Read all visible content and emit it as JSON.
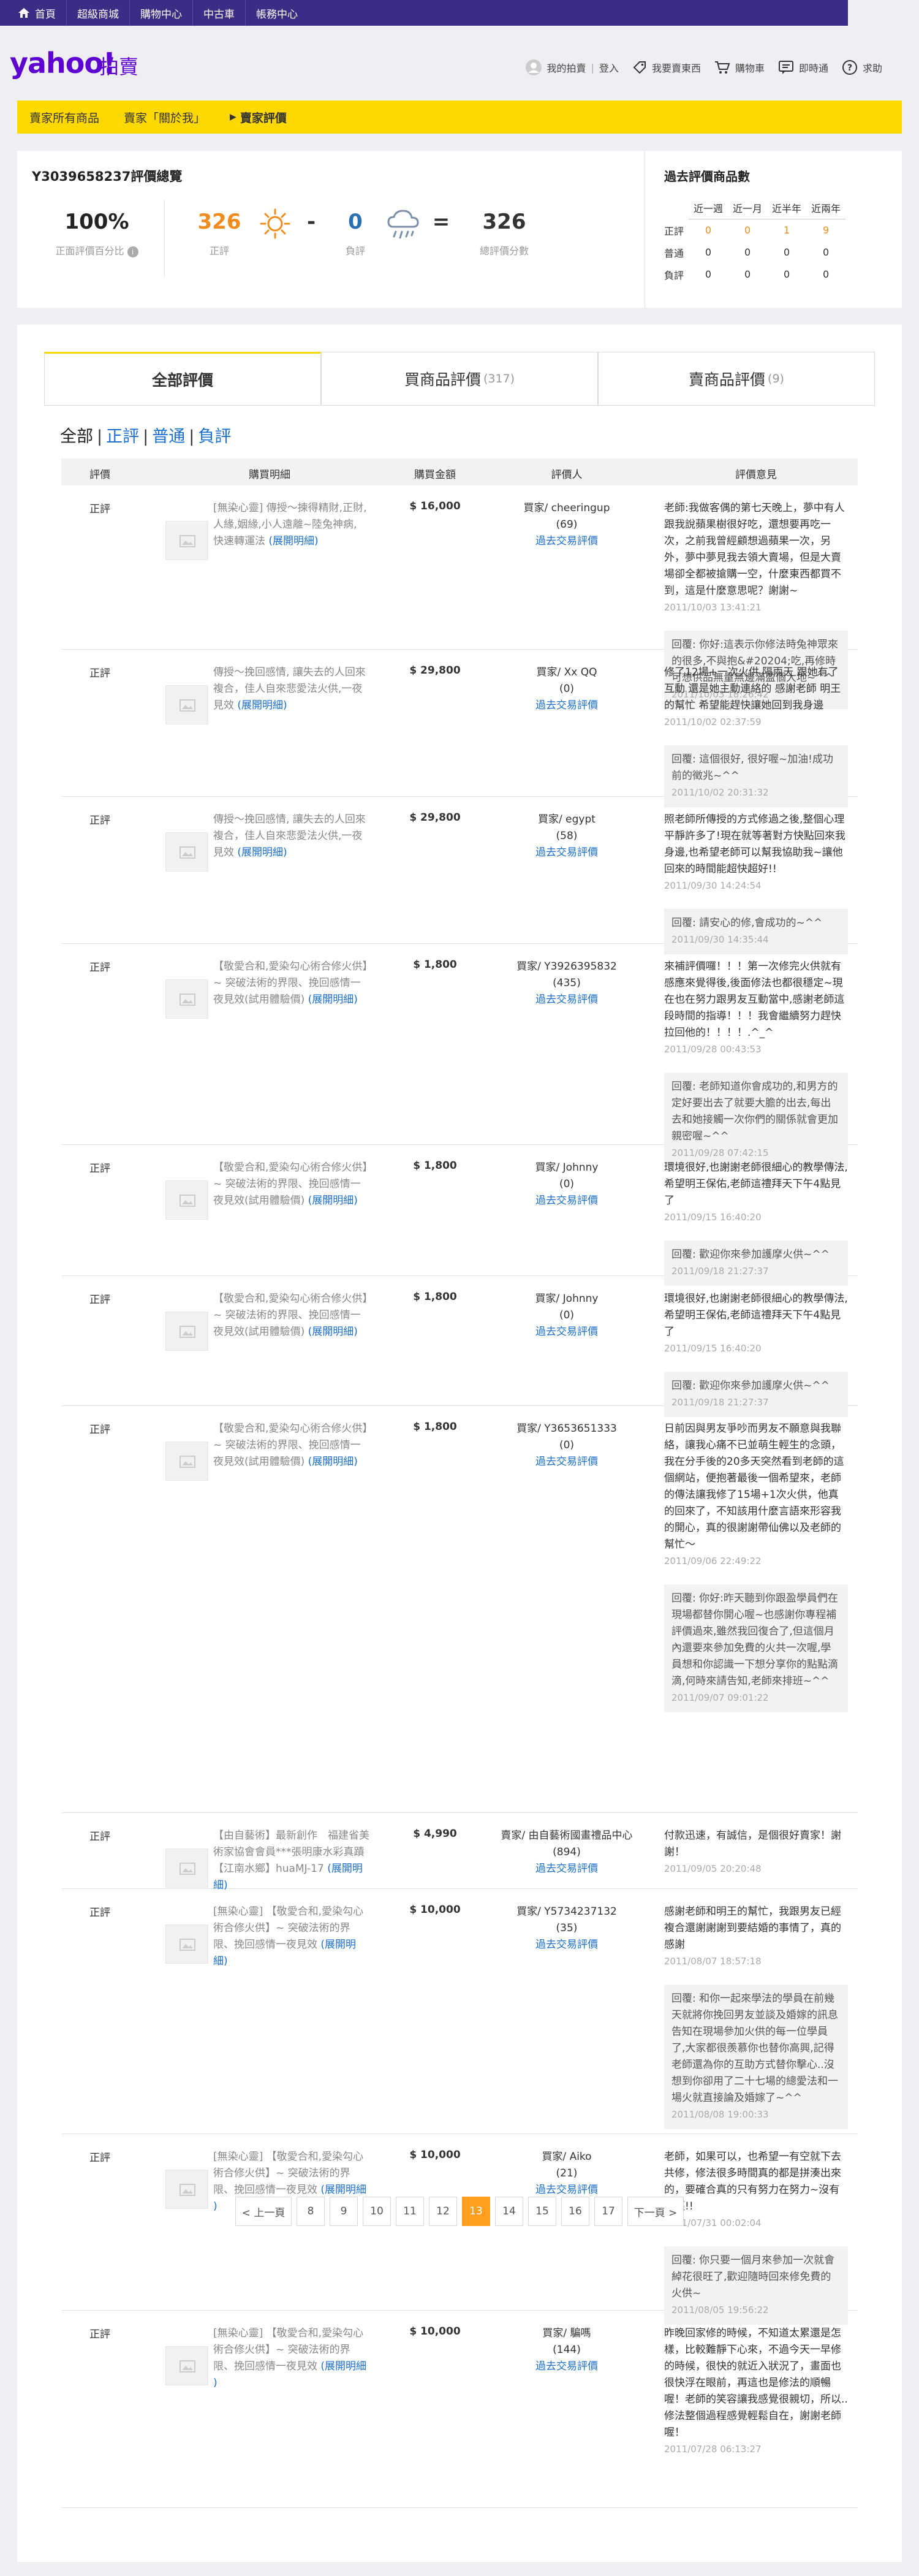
{
  "topnav": [
    "首頁",
    "超級商城",
    "購物中心",
    "中古車",
    "帳務中心"
  ],
  "brand": {
    "logo": "yahoo!",
    "sub": "拍賣"
  },
  "header": {
    "my_auction": "我的拍賣",
    "login": "登入",
    "sell": "我要賣東西",
    "cart": "購物車",
    "messenger": "即時通",
    "help": "求助"
  },
  "breadcrumb": {
    "items": [
      "賣家所有商品",
      "賣家「關於我」",
      "賣家評價"
    ]
  },
  "summary": {
    "title": "Y3039658237評價總覽",
    "positive_rate": "100%",
    "positive_rate_label": "正面評價百分比",
    "positive": "326",
    "positive_label": "正評",
    "minus": "-",
    "negative": "0",
    "negative_label": "負評",
    "equals": "=",
    "total": "326",
    "total_label": "總評價分數"
  },
  "past_ratings": {
    "title": "過去評價商品數",
    "columns": [
      "近一週",
      "近一月",
      "近半年",
      "近兩年"
    ],
    "rows": [
      {
        "label": "正評",
        "values": [
          "0",
          "0",
          "1",
          "9"
        ]
      },
      {
        "label": "普通",
        "values": [
          "0",
          "0",
          "0",
          "0"
        ]
      },
      {
        "label": "負評",
        "values": [
          "0",
          "0",
          "0",
          "0"
        ]
      }
    ]
  },
  "tabs": [
    {
      "label": "全部評價",
      "count": ""
    },
    {
      "label": "買商品評價",
      "count": "(317)"
    },
    {
      "label": "賣商品評價",
      "count": "(9)"
    }
  ],
  "filters": [
    "全部",
    "正評",
    "普通",
    "負評"
  ],
  "table_headers": [
    "評價",
    "購買明細",
    "購買金額",
    "評價人",
    "評價意見"
  ],
  "rows": [
    {
      "type": "正評",
      "item": "[無染心靈] 傳授～揀得精財,正財,人緣,姻緣,小人遠離~陸兔神病, 快速轉運法",
      "expand": "(展開明細)",
      "price": "$ 16,000",
      "rater": "買家/ cheeringup",
      "rater_score": "(69)",
      "history": "過去交易評價",
      "comment": "老師:我做客偶的第七天晚上，夢中有人跟我說蘋果樹很好吃，還想要再吃一次，之前我曾經顧想過蘋果一次，另外，夢中夢見我去領大賣場，但是大賣場卻全都被搶購一空，什麼東西都買不到，這是什麼意思呢？謝謝~",
      "comment_ts": "2011/10/03 13:41:21",
      "reply": "回覆: 你好:這表示你修法時兔神眾來的很多,不與抱&#20204;吃,再修時可想供品無量無邊滿盈個大地~^^",
      "reply_ts": "2011/10/03 18:26:42"
    },
    {
      "type": "正評",
      "item": "傳授～挽回感情, 讓失去的人回來複合，佳人自來悲愛法火供,一夜見效",
      "expand": "(展開明細)",
      "price": "$ 29,800",
      "rater": "買家/ Xx QQ",
      "rater_score": "(0)",
      "history": "過去交易評價",
      "comment": "修了12場+一次火供 隔兩天 跟她有了互動 還是她主動連絡的 感謝老師 明王的幫忙 希望能趕快讓她回到我身邊",
      "comment_ts": "2011/10/02 02:37:59",
      "reply": "回覆: 這個很好, 很好喔~加油!成功前的徵兆~^^",
      "reply_ts": "2011/10/02 20:31:32"
    },
    {
      "type": "正評",
      "item": "傳授～挽回感情, 讓失去的人回來複合，佳人自來悲愛法火供,一夜見效",
      "expand": "(展開明細)",
      "price": "$ 29,800",
      "rater": "買家/ egypt",
      "rater_score": "(58)",
      "history": "過去交易評價",
      "comment": "照老師所傳授的方式修過之後,整個心理平靜許多了!現在就等著對方快點回來我身邊,也希望老師可以幫我協助我~讓他回來的時間能超快超好!!",
      "comment_ts": "2011/09/30 14:24:54",
      "reply": "回覆: 請安心的修,會成功的~^^",
      "reply_ts": "2011/09/30 14:35:44"
    },
    {
      "type": "正評",
      "item": "【敬愛合和,愛染勾心術合修火供】~ 突破法術的界限、挽回感情一夜見效(試用體驗價)",
      "expand": "(展開明細)",
      "price": "$ 1,800",
      "rater": "買家/ Y3926395832",
      "rater_score": "(435)",
      "history": "過去交易評價",
      "comment": "來補評價囉！！！第一次修完火供就有感應來覺得後,後面修法也都很穩定~現在也在努力跟男友互動當中,感謝老師這段時間的指導！！！我會繼續努力趕快拉回他的！！！！.^_^",
      "comment_ts": "2011/09/28 00:43:53",
      "reply": "回覆: 老師知道你會成功的,和男方的定好要出去了就要大膽的出去,每出去和她接觸一次你們的關係就會更加親密喔~^^",
      "reply_ts": "2011/09/28 07:42:15"
    },
    {
      "type": "正評",
      "item": "【敬愛合和,愛染勾心術合修火供】~ 突破法術的界限、挽回感情一夜見效(試用體驗價)",
      "expand": "(展開明細)",
      "price": "$ 1,800",
      "rater": "買家/ Johnny",
      "rater_score": "(0)",
      "history": "過去交易評價",
      "comment": "環境很好,也謝謝老師很細心的教學傳法, 希望明王保佑,老師這禮拜天下午4點見了",
      "comment_ts": "2011/09/15 16:40:20",
      "reply": "回覆: 歡迎你來參加護摩火供~^^",
      "reply_ts": "2011/09/18 21:27:37"
    },
    {
      "type": "正評",
      "item": "【敬愛合和,愛染勾心術合修火供】~ 突破法術的界限、挽回感情一夜見效(試用體驗價)",
      "expand": "(展開明細)",
      "price": "$ 1,800",
      "rater": "買家/ Johnny",
      "rater_score": "(0)",
      "history": "過去交易評價",
      "comment": "環境很好,也謝謝老師很細心的教學傳法, 希望明王保佑,老師這禮拜天下午4點見了",
      "comment_ts": "2011/09/15 16:40:20",
      "reply": "回覆: 歡迎你來參加護摩火供~^^",
      "reply_ts": "2011/09/18 21:27:37"
    },
    {
      "type": "正評",
      "item": "【敬愛合和,愛染勾心術合修火供】~ 突破法術的界限、挽回感情一夜見效(試用體驗價)",
      "expand": "(展開明細)",
      "price": "$ 1,800",
      "rater": "買家/ Y3653651333",
      "rater_score": "(0)",
      "history": "過去交易評價",
      "comment": "日前因與男友爭吵而男友不願意與我聯絡，讓我心痛不已並萌生輕生的念頭，我在分手後的20多天突然看到老師的這個網站，便抱著最後一個希望來，老師的傳法讓我修了15場+1次火供，他真的回來了，不知該用什麼言語來形容我的開心，真的很謝謝帶仙佛以及老師的幫忙～",
      "comment_ts": "2011/09/06 22:49:22",
      "reply": "回覆: 你好:昨天聽到你跟盈學員們在現場都替你開心喔~也感謝你專程補評價過來,雖然我回復合了,但這個月內還要來參加免費的火共一次喔,學員想和你認識一下想分享你的點點滴滴,何時來請告知,老師來排班~^^",
      "reply_ts": "2011/09/07 09:01:22"
    },
    {
      "type": "正評",
      "item": "【由自藝術】最新創作　福建省美術家協會會員***張明康水彩真蹟【江南水鄉】huaMJ-17",
      "expand": "(展開明細)",
      "price": "$ 4,990",
      "rater": "賣家/ 由自藝術國畫禮品中心",
      "rater_score": "(894)",
      "history": "過去交易評價",
      "comment": "付款迅速，有誠信，是個很好賣家！謝謝！",
      "comment_ts": "2011/09/05 20:20:48",
      "reply": "",
      "reply_ts": ""
    },
    {
      "type": "正評",
      "item": "[無染心靈] 【敬愛合和,愛染勾心術合修火供】~ 突破法術的界限、挽回感情一夜見效",
      "expand": "(展開明細)",
      "price": "$ 10,000",
      "rater": "買家/ Y5734237132",
      "rater_score": "(35)",
      "history": "過去交易評價",
      "comment": "感謝老師和明王的幫忙，我跟男友已經複合還謝謝謝到要結婚的事情了，真的感謝",
      "comment_ts": "2011/08/07 18:57:18",
      "reply": "回覆: 和你一起來學法的學員在前幾天就將你挽回男友並談及婚嫁的訊息告知在現場參加火供的每一位學員了,大家都很羨慕你也替你高興,記得老師還為你的互助方式替你擊心..沒想到你卻用了二十七場的總愛法和一場火就直接論及婚嫁了~^^",
      "reply_ts": "2011/08/08 19:00:33"
    },
    {
      "type": "正評",
      "item": "[無染心靈] 【敬愛合和,愛染勾心術合修火供】~ 突破法術的界限、挽回感情一夜見效",
      "expand": "(展開明細",
      "expand_tail": ")",
      "price": "$ 10,000",
      "rater": "買家/ Aiko",
      "rater_score": "(21)",
      "history": "過去交易評價",
      "comment": "老師，如果可以，也希望一有空就下去共修，修法很多時間真的都是拼湊出來的，要確合真的只有努力在努力~沒有捷徑!!",
      "comment_ts": "2011/07/31 00:02:04",
      "reply": "回覆: 你只要一個月來參加一次就會綽花很旺了,歡迎隨時回來修免費的火供~",
      "reply_ts": "2011/08/05 19:56:22"
    },
    {
      "type": "正評",
      "item": "[無染心靈] 【敬愛合和,愛染勾心術合修火供】~ 突破法術的界限、挽回感情一夜見效",
      "expand": "(展開明細",
      "expand_tail": ")",
      "price": "$ 10,000",
      "rater": "買家/ 騙嗎",
      "rater_score": "(144)",
      "history": "過去交易評價",
      "comment": "昨晚回家修的時候，不知道太累還是怎樣，比較難靜下心來，不過今天一早修的時候，很快的就近入狀況了，畫面也很快浮在眼前，再這也是修法的順暢喔！老師的笑容讓我感覺很親切，所以..修法整個過程感覺輕鬆自在，謝謝老師喔！",
      "comment_ts": "2011/07/28 06:13:27",
      "reply": "",
      "reply_ts": ""
    }
  ],
  "pager": {
    "prev": "< 上一頁",
    "pages": [
      "8",
      "9",
      "10",
      "11",
      "12",
      "13",
      "14",
      "15",
      "16",
      "17"
    ],
    "current": "13",
    "next": "下一頁 >"
  },
  "colors": {
    "topbar": "#3c2c86",
    "brand": "#5f01d1",
    "yellow": "#ffd800",
    "positive": "#f08c1e",
    "link": "#1a6fcf",
    "current_page": "#ff9e1f"
  }
}
